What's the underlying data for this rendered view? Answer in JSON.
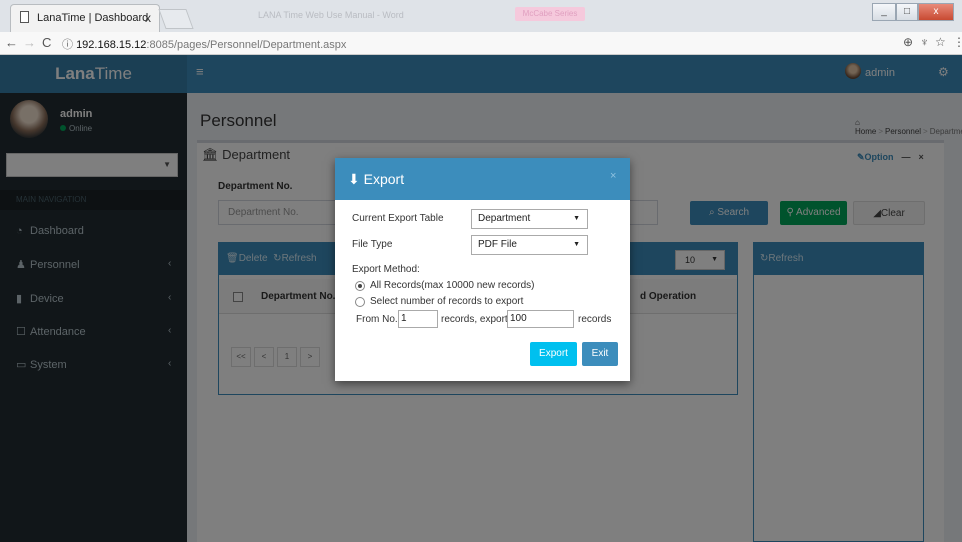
{
  "browser": {
    "tab_title": "LanaTime | Dashboard",
    "tab_close": "x",
    "blurred_title": "LANA Time Web Use Manual - Word",
    "blurred_pink": "McCabe Series",
    "url_host": "192.168.15.12",
    "url_rest": ":8085/pages/Personnel/Department.aspx",
    "win_min": "_",
    "win_max": "□",
    "win_close": "x"
  },
  "header": {
    "logo_bold": "Lana",
    "logo_light": "Time",
    "user": "admin"
  },
  "sidebar": {
    "user_name": "admin",
    "status": "Online",
    "section_label": "MAIN NAVIGATION",
    "items": [
      {
        "label": "Dashboard",
        "icon": "dashboard-icon"
      },
      {
        "label": "Personnel",
        "icon": "users-icon"
      },
      {
        "label": "Device",
        "icon": "device-icon"
      },
      {
        "label": "Attendance",
        "icon": "calendar-icon"
      },
      {
        "label": "System",
        "icon": "monitor-icon"
      }
    ]
  },
  "page": {
    "title": "Personnel",
    "breadcrumb": [
      "Home",
      "Personnel",
      "Department"
    ],
    "box_title": "Department",
    "option": "Option",
    "dep_label": "Department No.",
    "dep_placeholder": "Department No.",
    "search": "Search",
    "advanced": "Advanced",
    "clear": "Clear",
    "delete": "Delete",
    "refresh": "Refresh",
    "page_size": "10",
    "col_department": "Department No.",
    "col_operation": "d Operation",
    "pager": [
      "<<",
      "<",
      "1",
      ">"
    ],
    "side_refresh": "Refresh"
  },
  "modal": {
    "title": "Export",
    "close": "×",
    "table_label": "Current Export Table",
    "table_value": "Department",
    "filetype_label": "File Type",
    "filetype_value": "PDF File",
    "method_label": "Export Method:",
    "opt_all": "All Records(max 10000 new records)",
    "opt_select": "Select number of records to export",
    "from_label": "From No.",
    "from_value": "1",
    "mid_label": "records, export total",
    "total_value": "100",
    "end_label": "records",
    "export_btn": "Export",
    "exit_btn": "Exit"
  }
}
